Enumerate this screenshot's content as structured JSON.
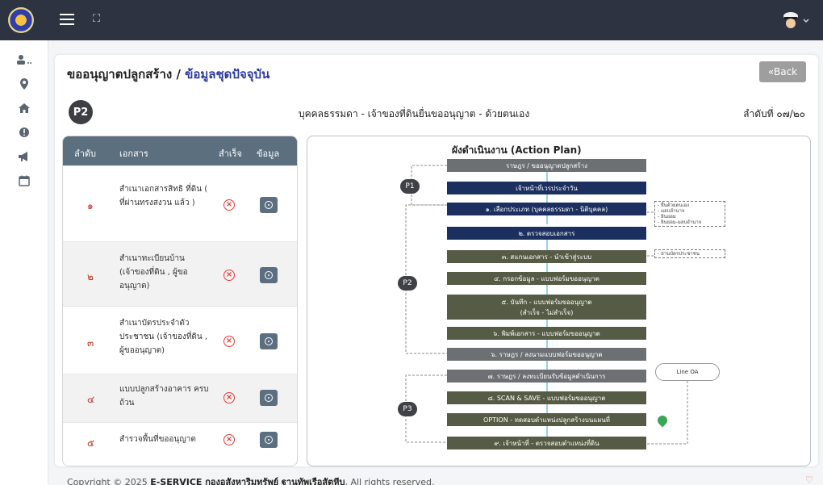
{
  "topbar": {
    "menu_icon": "hamburger-icon",
    "expand_icon": "fullscreen-icon",
    "user_icon": "navy-captain-avatar-icon"
  },
  "sidebar": {
    "items": [
      "user-list-icon",
      "map-pin-icon",
      "home-icon",
      "alert-icon",
      "megaphone-icon",
      "calendar-icon"
    ]
  },
  "page": {
    "title_main": "ขออนุญาตปลูกสร้าง / ",
    "title_sub": "ข้อมูลชุดปัจจุบัน",
    "back_label": "«Back",
    "badge": "P2",
    "heading_center": "บุคคลธรรมดา - เจ้าของที่ดินยื่นขออนุญาต - ด้วยตนเอง",
    "heading_right": "ลำดับที่ ๐๗/๒๐"
  },
  "doc_table": {
    "headers": [
      "ลำดับ",
      "เอกสาร",
      "สำเร็จ",
      "ข้อมูล"
    ],
    "rows": [
      {
        "num": "๑",
        "text": "สำเนาเอกสารสิทธิ ที่ดิน ( ที่ผ่านทรงสงวน แล้ว )"
      },
      {
        "num": "๒",
        "text": "สำเนาทะเบียนบ้าน (เจ้าของที่ดิน , ผู้ขอ อนุญาต)"
      },
      {
        "num": "๓",
        "text": "สำเนาบัตรประจำตัว ประชาชน (เจ้าของที่ดิน , ผู้ขออนุญาต)"
      },
      {
        "num": "๔",
        "text": "แบบปลูกสร้างอาคาร ครบถ้วน"
      },
      {
        "num": "๕",
        "text": "สำรวจพื้นที่ขออนุญาต"
      }
    ]
  },
  "flow": {
    "title": "ผังดำเนินงาน (Action Plan)",
    "boxes": [
      "ราษฎร / ขออนุญาตปลูกสร้าง",
      "เจ้าหน้าที่เวรประจำวัน",
      "๑. เลือกประเภท (บุคคลธรรมดา - นิติบุคคล)",
      "๒. ตรวจสอบเอกสาร",
      "๓. สแกนเอกสาร - นำเข้าสู่ระบบ",
      "๔. กรอกข้อมูล - แบบฟอร์มขออนุญาต",
      "๕. บันทึก - แบบฟอร์มขออนุญาต",
      "(สำเร็จ - ไม่สำเร็จ)",
      "๖. พิมพ์เอกสาร - แบบฟอร์มขออนุญาต",
      "๖. ราษฎร / ลงนามแบบฟอร์มขออนุญาต",
      "๗. ราษฎร / ลงทะเบียนรับข้อมูลดำเนินการ",
      "๘. SCAN & SAVE - แบบฟอร์มขออนุญาต",
      "OPTION - ทดสอบตำแหน่งปลูกสร้างบนแผนที่",
      "๙. เจ้าหน้าที่ - ตรวจสอบตำแหน่งที่ดิน"
    ],
    "p_labels": [
      "P1",
      "P2",
      "P3"
    ],
    "note1": [
      "- ยื่นด้วยตนเอง",
      "- มอบอำนาจ",
      "- ยินยอม",
      "- ยินยอม-มอบอำนาจ"
    ],
    "note2": "- อ่านบัตรประชาชน",
    "cloud": "Line OA"
  },
  "footer": {
    "prefix": "Copyright © 2025 ",
    "brand": "E-SERVICE กองอสังหาริมทรัพย์ ฐานทัพเรือสัตหีบ",
    "suffix": ", All rights reserved."
  }
}
